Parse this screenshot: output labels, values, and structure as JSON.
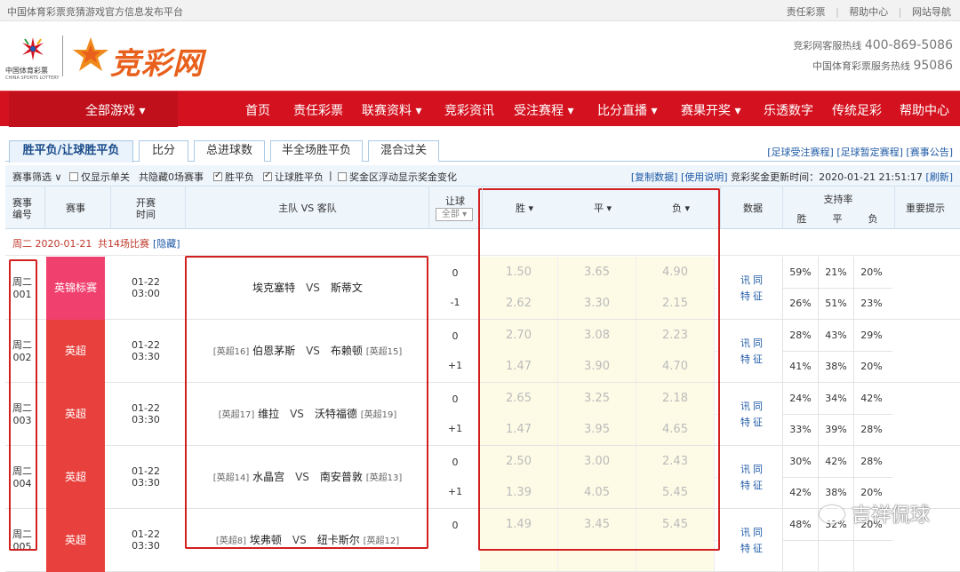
{
  "topbar": {
    "site_desc": "中国体育彩票竞猜游戏官方信息发布平台",
    "links": [
      "责任彩票",
      "帮助中心",
      "网站导航"
    ]
  },
  "header": {
    "lottery_logo_cn": "中国体育彩票",
    "lottery_logo_en": "CHINA SPORTS LOTTERY",
    "brand": "竞彩网",
    "hotline1_label": "竞彩网客服热线",
    "hotline1_number": "400-869-5086",
    "hotline2_label": "中国体育彩票服务热线",
    "hotline2_number": "95086"
  },
  "nav": {
    "all_games": "全部游戏 ▾",
    "items": [
      "首页",
      "责任彩票",
      "联赛资料 ▾",
      "竞彩资讯",
      "受注赛程 ▾",
      "比分直播 ▾",
      "赛果开奖 ▾",
      "乐透数字",
      "传统足彩",
      "帮助中心"
    ]
  },
  "tabs": [
    "胜平负/让球胜平负",
    "比分",
    "总进球数",
    "半全场胜平负",
    "混合过关"
  ],
  "tab_links": "[足球受注赛程] [足球暂定赛程] [赛事公告]",
  "filter": {
    "label": "赛事筛选 ∨",
    "single_only": "仅显示单关",
    "hidden_count": "共隐藏0场赛事",
    "spf": "胜平负",
    "rqspf": "让球胜平负",
    "sep": "|",
    "float_prize": "奖金区浮动显示奖金变化",
    "copy": "[复制数据]",
    "usage": "[使用说明]",
    "update_label": "竞彩奖金更新时间：",
    "update_time": "2020-01-21 21:51:17",
    "refresh": "[刷新]"
  },
  "thead": {
    "code": "赛事\n编号",
    "league": "赛事",
    "time": "开赛\n时间",
    "teams": "主队 VS 客队",
    "handicap": "让球",
    "handicap_select": "全部 ▾",
    "win": "胜 ▾",
    "draw": "平 ▾",
    "lose": "负 ▾",
    "data": "数据",
    "support": "支持率",
    "s_win": "胜",
    "s_draw": "平",
    "s_lose": "负",
    "notice": "重要提示"
  },
  "day_bar": {
    "date": "周二 2020-01-21",
    "count": "共14场比赛",
    "hide": "[隐藏]"
  },
  "matches": [
    {
      "code1": "周二",
      "code2": "001",
      "league": "英锦标赛",
      "league_color": "#f0406e",
      "date": "01-22",
      "time": "03:00",
      "home_rank": "",
      "home": "埃克塞特",
      "vs": "VS",
      "away": "斯蒂文",
      "away_rank": "",
      "hc1": "0",
      "hc2": "-1",
      "odds1": [
        "1.50",
        "3.65",
        "4.90"
      ],
      "odds2": [
        "2.62",
        "3.30",
        "2.15"
      ],
      "data1": "讯同",
      "data2": "特征",
      "sup1": [
        "59%",
        "21%",
        "20%"
      ],
      "sup2": [
        "26%",
        "51%",
        "23%"
      ]
    },
    {
      "code1": "周二",
      "code2": "002",
      "league": "英超",
      "league_color": "#e8403c",
      "date": "01-22",
      "time": "03:30",
      "home_rank": "[英超16]",
      "home": "伯恩茅斯",
      "vs": "VS",
      "away": "布赖顿",
      "away_rank": "[英超15]",
      "hc1": "0",
      "hc2": "+1",
      "odds1": [
        "2.70",
        "3.08",
        "2.23"
      ],
      "odds2": [
        "1.47",
        "3.90",
        "4.70"
      ],
      "data1": "讯同",
      "data2": "特征",
      "sup1": [
        "28%",
        "43%",
        "29%"
      ],
      "sup2": [
        "41%",
        "38%",
        "20%"
      ]
    },
    {
      "code1": "周二",
      "code2": "003",
      "league": "英超",
      "league_color": "#e8403c",
      "date": "01-22",
      "time": "03:30",
      "home_rank": "[英超17]",
      "home": "维拉",
      "vs": "VS",
      "away": "沃特福德",
      "away_rank": "[英超19]",
      "hc1": "0",
      "hc2": "+1",
      "odds1": [
        "2.65",
        "3.25",
        "2.18"
      ],
      "odds2": [
        "1.47",
        "3.95",
        "4.65"
      ],
      "data1": "讯同",
      "data2": "特征",
      "sup1": [
        "24%",
        "34%",
        "42%"
      ],
      "sup2": [
        "33%",
        "39%",
        "28%"
      ]
    },
    {
      "code1": "周二",
      "code2": "004",
      "league": "英超",
      "league_color": "#e8403c",
      "date": "01-22",
      "time": "03:30",
      "home_rank": "[英超14]",
      "home": "水晶宫",
      "vs": "VS",
      "away": "南安普敦",
      "away_rank": "[英超13]",
      "hc1": "0",
      "hc2": "+1",
      "odds1": [
        "2.50",
        "3.00",
        "2.43"
      ],
      "odds2": [
        "1.39",
        "4.05",
        "5.45"
      ],
      "data1": "讯同",
      "data2": "特征",
      "sup1": [
        "30%",
        "42%",
        "28%"
      ],
      "sup2": [
        "42%",
        "38%",
        "20%"
      ]
    },
    {
      "code1": "周二",
      "code2": "005",
      "league": "英超",
      "league_color": "#e8403c",
      "date": "01-22",
      "time": "03:30",
      "home_rank": "[英超8]",
      "home": "埃弗顿",
      "vs": "VS",
      "away": "纽卡斯尔",
      "away_rank": "[英超12]",
      "hc1": "0",
      "hc2": "",
      "odds1": [
        "1.49",
        "3.45",
        "5.45"
      ],
      "odds2": [
        "",
        "",
        ""
      ],
      "data1": "讯同",
      "data2": "特征",
      "sup1": [
        "48%",
        "32%",
        "20%"
      ],
      "sup2": [
        "",
        "",
        ""
      ]
    }
  ],
  "watermark": "吉祥侃球"
}
